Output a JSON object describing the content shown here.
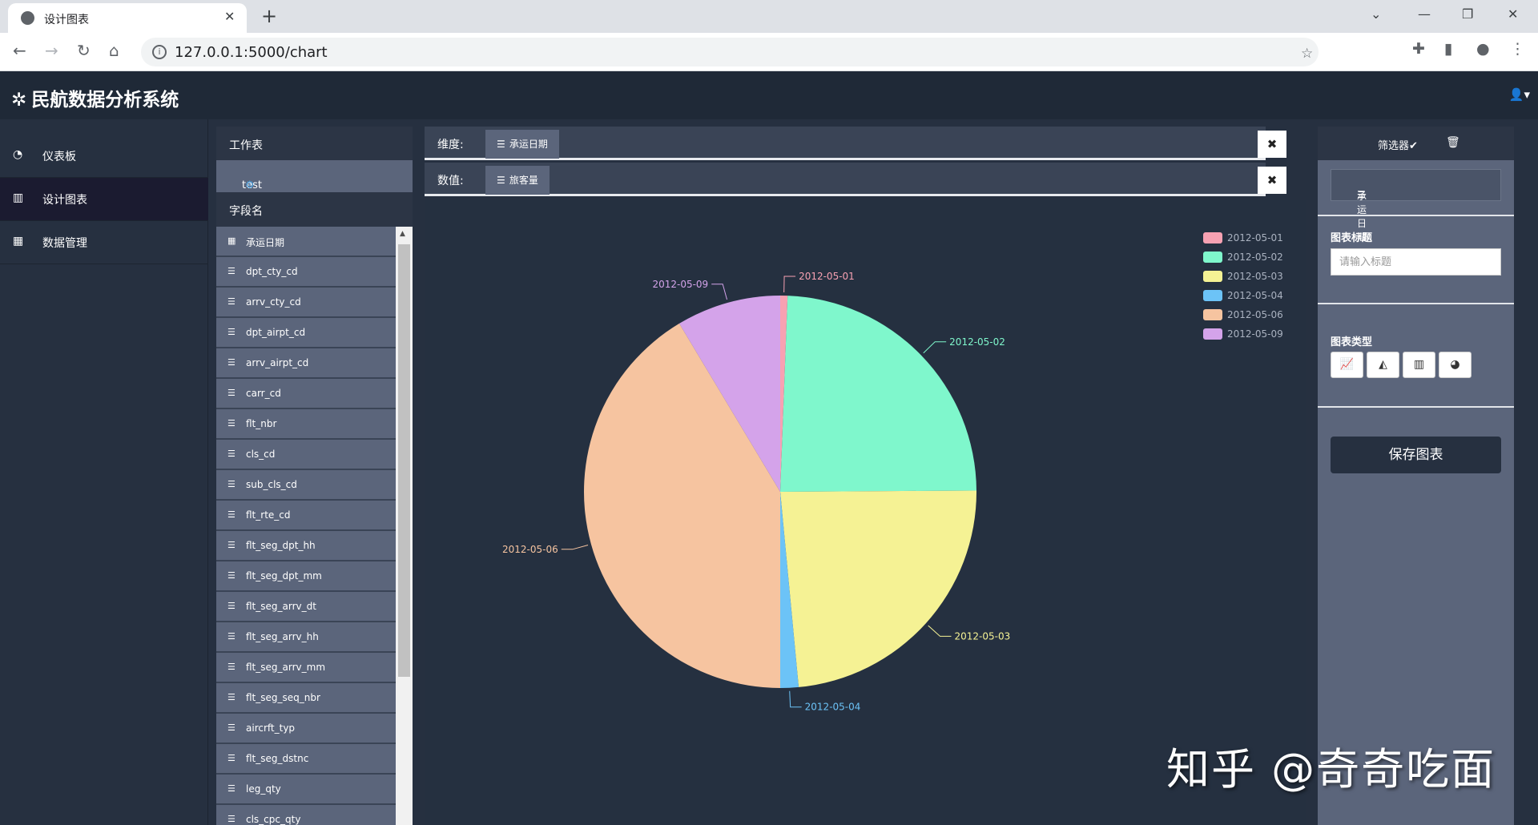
{
  "browser": {
    "tab_title": "设计图表",
    "url": "127.0.0.1:5000/chart"
  },
  "app": {
    "brand": "民航数据分析系统"
  },
  "sidebar": {
    "items": [
      {
        "label": "仪表板",
        "icon": "dashboard-icon"
      },
      {
        "label": "设计图表",
        "icon": "bar-chart-icon",
        "active": true
      },
      {
        "label": "数据管理",
        "icon": "table-icon"
      }
    ]
  },
  "worksheet": {
    "header": "工作表",
    "sheet_name": "test",
    "fields_header": "字段名",
    "fields": [
      "承运日期",
      "dpt_cty_cd",
      "arrv_cty_cd",
      "dpt_airpt_cd",
      "arrv_airpt_cd",
      "carr_cd",
      "flt_nbr",
      "cls_cd",
      "sub_cls_cd",
      "flt_rte_cd",
      "flt_seg_dpt_hh",
      "flt_seg_dpt_mm",
      "flt_seg_arrv_dt",
      "flt_seg_arrv_hh",
      "flt_seg_arrv_mm",
      "flt_seg_seq_nbr",
      "aircrft_typ",
      "flt_seg_dstnc",
      "leg_qty",
      "cls_cpc_qty"
    ]
  },
  "shelves": {
    "dimension_label": "维度:",
    "dimension_value": "承运日期",
    "measure_label": "数值:",
    "measure_value": "旅客量",
    "close_glyph": "✖"
  },
  "settings": {
    "filter_label": "筛选器✔",
    "filter_field": "承运日期",
    "chart_title_label": "图表标题",
    "chart_title_placeholder": "请输入标题",
    "chart_type_label": "图表类型",
    "save_label": "保存图表"
  },
  "chart_data": {
    "type": "pie",
    "categories": [
      "2012-05-01",
      "2012-05-02",
      "2012-05-03",
      "2012-05-04",
      "2012-05-06",
      "2012-05-09"
    ],
    "values": [
      0.6,
      24.3,
      23.6,
      1.5,
      41.4,
      8.6
    ],
    "colors": [
      "#f7a1b2",
      "#7ff7cc",
      "#f5f294",
      "#6cc3f7",
      "#f6c4a0",
      "#d4a3ea"
    ],
    "legend_position": "top-right"
  },
  "watermark": "知乎 @奇奇吃面"
}
